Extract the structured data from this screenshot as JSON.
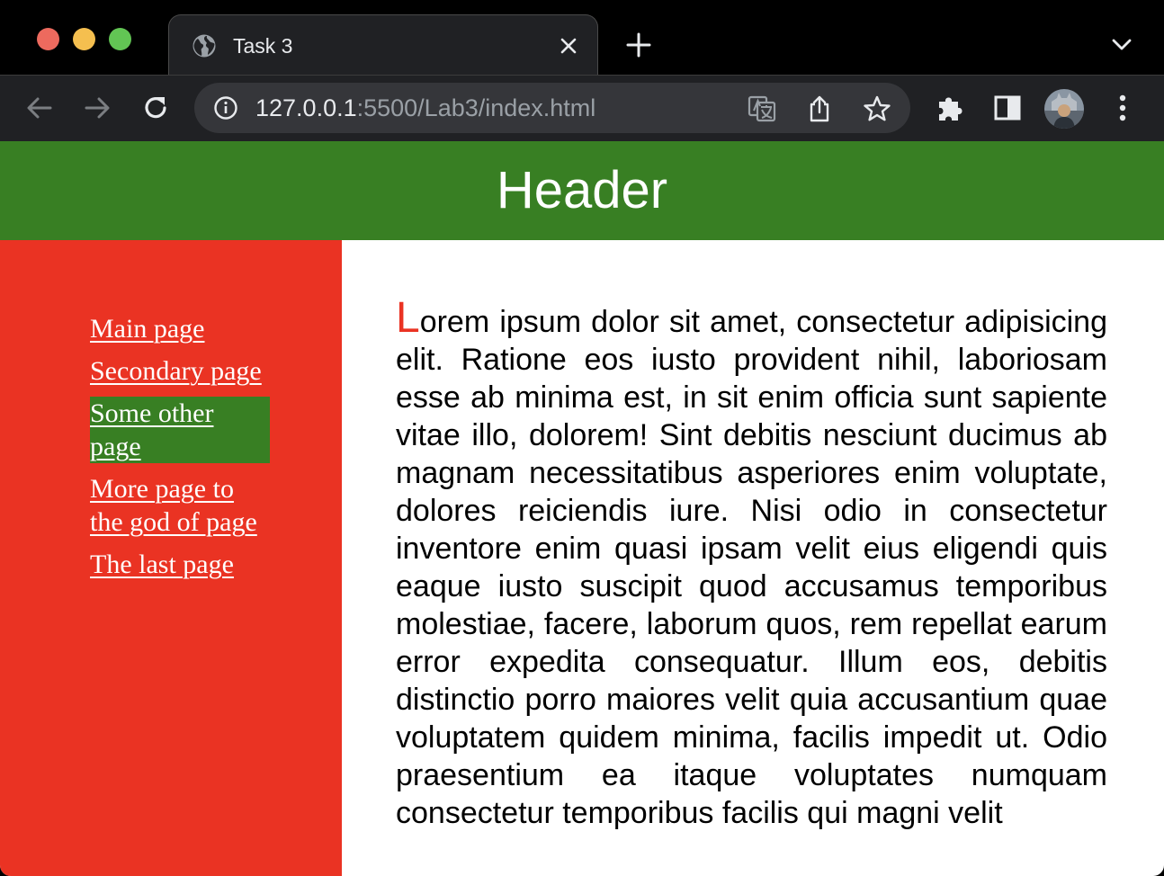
{
  "browser": {
    "tab": {
      "title": "Task 3"
    },
    "address_bar": {
      "host": "127.0.0.1",
      "path": ":5500/Lab3/index.html"
    },
    "icons": {
      "back": "arrow-left-icon",
      "forward": "arrow-right-icon",
      "reload": "reload-icon",
      "site_info": "info-circle-icon",
      "translate": "translate-icon",
      "share": "share-icon",
      "bookmark": "star-icon",
      "extensions": "puzzle-icon",
      "side_panel": "side-panel-icon",
      "menu": "kebab-menu-icon"
    },
    "colors": {
      "frame": "#000000",
      "toolbar": "#202124",
      "omnibox": "#35363a"
    }
  },
  "page": {
    "header": {
      "title": "Header",
      "background": "#387f23"
    },
    "sidebar": {
      "background": "#ea3323",
      "items": [
        {
          "label": "Main page",
          "active": false
        },
        {
          "label": "Secondary page",
          "active": false
        },
        {
          "label": "Some other page",
          "active": true
        },
        {
          "label": "More page to the god of page",
          "active": false
        },
        {
          "label": "The last page",
          "active": false
        }
      ]
    },
    "content": {
      "first_letter": "L",
      "text": "orem ipsum dolor sit amet, consectetur adipisicing elit. Ratione eos iusto provident nihil, laboriosam esse ab minima est, in sit enim officia sunt sapiente vitae illo, dolorem! Sint debitis nesciunt ducimus ab magnam necessitatibus asperiores enim voluptate, dolores reiciendis iure. Nisi odio in consectetur inventore enim quasi ipsam velit eius eligendi quis eaque iusto suscipit quod accusamus temporibus molestiae, facere, laborum quos, rem repellat earum error expedita consequatur. Illum eos, debitis distinctio porro maiores velit quia accusantium quae voluptatem quidem minima, facilis impedit ut. Odio praesentium ea itaque voluptates numquam consectetur temporibus facilis qui magni velit"
    }
  }
}
